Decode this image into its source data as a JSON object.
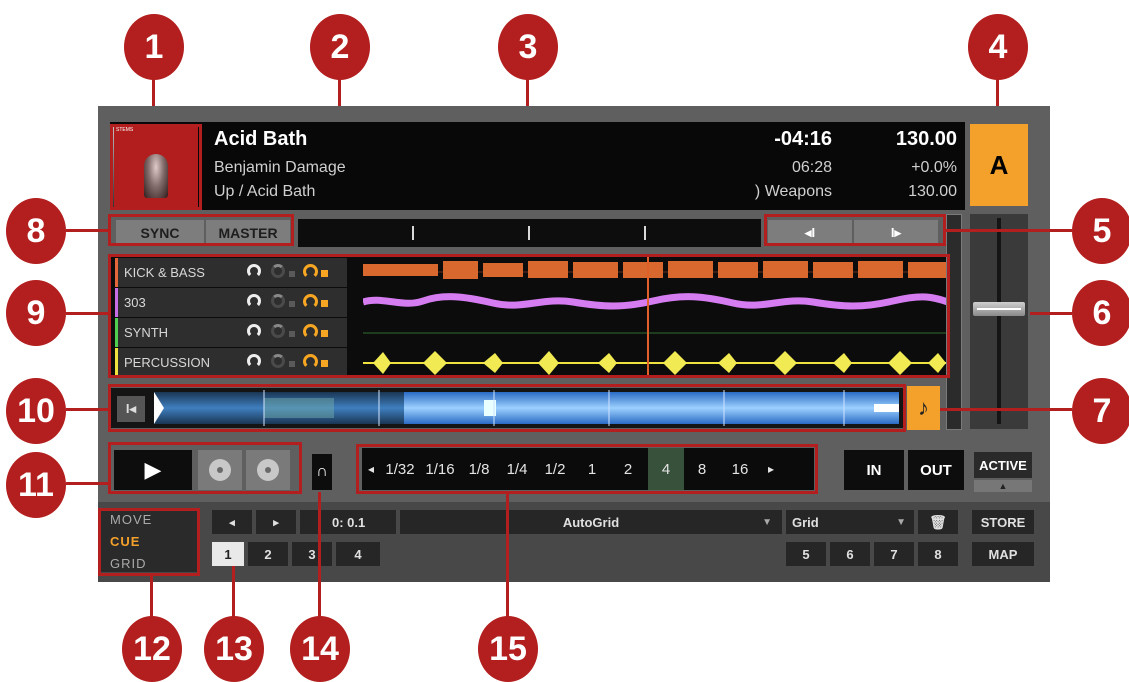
{
  "track": {
    "title": "Acid Bath",
    "artist": "Benjamin Damage",
    "album": "Up / Acid Bath",
    "remaining": "-04:16",
    "length": "06:28",
    "extra": ") Weapons",
    "bpm": "130.00",
    "tempo": "+0.0%",
    "bpm_original": "130.00",
    "cover_badge": "STEMS"
  },
  "deck_letter": "A",
  "buttons": {
    "sync": "SYNC",
    "master": "MASTER",
    "beat_back": "◂I",
    "beat_fwd": "I▸",
    "play": "▶",
    "in": "IN",
    "out": "OUT",
    "active": "ACTIVE",
    "active_arrow": "▲",
    "store": "STORE",
    "map": "MAP",
    "note": "♪",
    "snap": "∩"
  },
  "stems": [
    {
      "name": "KICK & BASS",
      "color": "#e3673a"
    },
    {
      "name": "303",
      "color": "#c76ee6"
    },
    {
      "name": "SYNTH",
      "color": "#4fce50"
    },
    {
      "name": "PERCUSSION",
      "color": "#efe23e"
    }
  ],
  "loop_sizes": [
    "1/32",
    "1/16",
    "1/8",
    "1/4",
    "1/2",
    "1",
    "2",
    "4",
    "8",
    "16"
  ],
  "loop_selected": "4",
  "loop_nav": {
    "left": "◂",
    "right": "▸"
  },
  "bottom": {
    "nav_left": "◂",
    "nav_right": "▸",
    "position": "0: 0.1",
    "autogrid": "AutoGrid",
    "grid": "Grid",
    "cues_left": [
      "1",
      "2",
      "3",
      "4"
    ],
    "cues_right": [
      "5",
      "6",
      "7",
      "8"
    ]
  },
  "modes": [
    "MOVE",
    "CUE",
    "GRID"
  ],
  "active_mode": "CUE",
  "callouts": [
    "1",
    "2",
    "3",
    "4",
    "5",
    "6",
    "7",
    "8",
    "9",
    "10",
    "11",
    "12",
    "13",
    "14",
    "15"
  ],
  "colors": {
    "accent": "#f4a12b",
    "callout": "#b31e1e"
  }
}
